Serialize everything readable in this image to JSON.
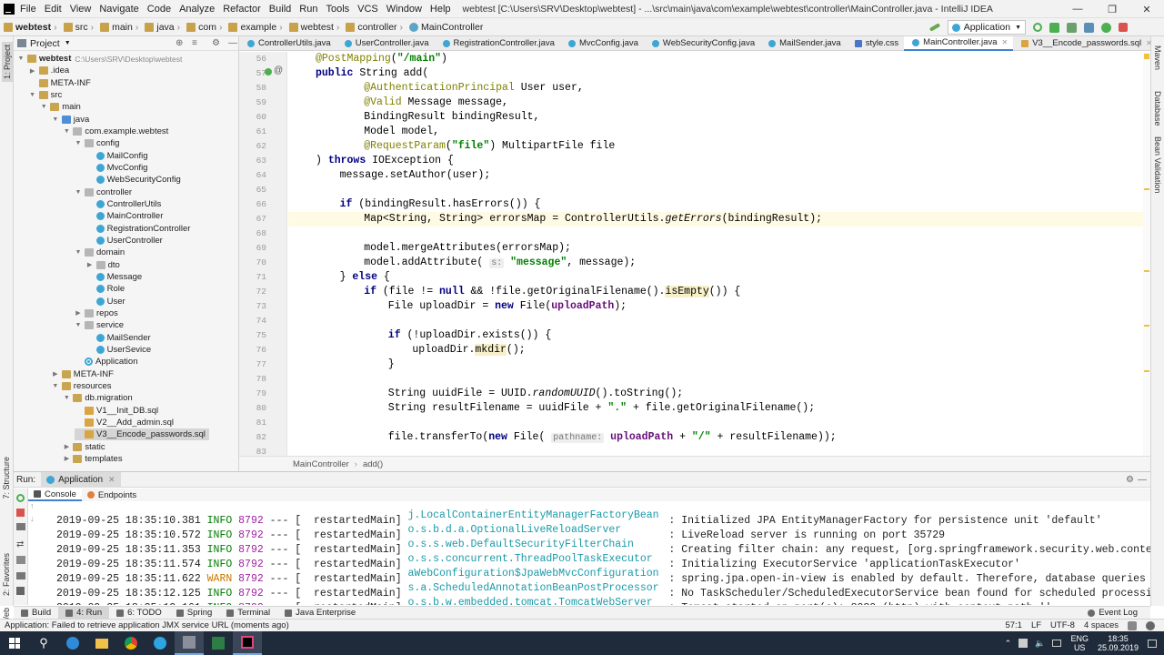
{
  "menubar": {
    "items": [
      "File",
      "Edit",
      "View",
      "Navigate",
      "Code",
      "Analyze",
      "Refactor",
      "Build",
      "Run",
      "Tools",
      "VCS",
      "Window",
      "Help"
    ],
    "window_title": "webtest [C:\\Users\\SRV\\Desktop\\webtest] - ...\\src\\main\\java\\com\\example\\webtest\\controller\\MainController.java - IntelliJ IDEA"
  },
  "navbar": {
    "breadcrumb": [
      "webtest",
      "src",
      "main",
      "java",
      "com",
      "example",
      "webtest",
      "controller",
      "MainController"
    ],
    "run_config": "Application"
  },
  "sidebar_left": {
    "project_label": "1: Project",
    "structure_label": "7: Structure",
    "favorites_label": "2: Favorites",
    "web_label": "Web"
  },
  "sidebar_right": {
    "maven_label": "Maven",
    "database_label": "Database",
    "bean_label": "Bean Validation"
  },
  "project": {
    "title": "Project",
    "root_name": "webtest",
    "root_path": "C:\\Users\\SRV\\Desktop\\webtest",
    "tree": [
      {
        "label": "webtest",
        "depth": 0,
        "icon": "folder",
        "arrow": "open",
        "path": "C:\\Users\\SRV\\Desktop\\webtest"
      },
      {
        "label": ".idea",
        "depth": 1,
        "icon": "folder",
        "arrow": "closed"
      },
      {
        "label": "META-INF",
        "depth": 1,
        "icon": "folder",
        "arrow": ""
      },
      {
        "label": "src",
        "depth": 1,
        "icon": "folder",
        "arrow": "open"
      },
      {
        "label": "main",
        "depth": 2,
        "icon": "folder",
        "arrow": "open"
      },
      {
        "label": "java",
        "depth": 3,
        "icon": "src",
        "arrow": "open"
      },
      {
        "label": "com.example.webtest",
        "depth": 4,
        "icon": "pkg",
        "arrow": "open"
      },
      {
        "label": "config",
        "depth": 5,
        "icon": "pkg",
        "arrow": "open"
      },
      {
        "label": "MailConfig",
        "depth": 6,
        "icon": "cls",
        "arrow": ""
      },
      {
        "label": "MvcConfig",
        "depth": 6,
        "icon": "cls",
        "arrow": ""
      },
      {
        "label": "WebSecurityConfig",
        "depth": 6,
        "icon": "cls",
        "arrow": ""
      },
      {
        "label": "controller",
        "depth": 5,
        "icon": "pkg",
        "arrow": "open"
      },
      {
        "label": "ControllerUtils",
        "depth": 6,
        "icon": "cls",
        "arrow": ""
      },
      {
        "label": "MainController",
        "depth": 6,
        "icon": "cls",
        "arrow": ""
      },
      {
        "label": "RegistrationController",
        "depth": 6,
        "icon": "cls",
        "arrow": ""
      },
      {
        "label": "UserController",
        "depth": 6,
        "icon": "cls",
        "arrow": ""
      },
      {
        "label": "domain",
        "depth": 5,
        "icon": "pkg",
        "arrow": "open"
      },
      {
        "label": "dto",
        "depth": 6,
        "icon": "pkg",
        "arrow": "closed"
      },
      {
        "label": "Message",
        "depth": 6,
        "icon": "cls",
        "arrow": ""
      },
      {
        "label": "Role",
        "depth": 6,
        "icon": "cls",
        "arrow": ""
      },
      {
        "label": "User",
        "depth": 6,
        "icon": "cls",
        "arrow": ""
      },
      {
        "label": "repos",
        "depth": 5,
        "icon": "pkg",
        "arrow": "closed"
      },
      {
        "label": "service",
        "depth": 5,
        "icon": "pkg",
        "arrow": "open"
      },
      {
        "label": "MailSender",
        "depth": 6,
        "icon": "cls",
        "arrow": ""
      },
      {
        "label": "UserSevice",
        "depth": 6,
        "icon": "cls",
        "arrow": ""
      },
      {
        "label": "Application",
        "depth": 5,
        "icon": "app",
        "arrow": ""
      },
      {
        "label": "META-INF",
        "depth": 3,
        "icon": "folder",
        "arrow": "closed"
      },
      {
        "label": "resources",
        "depth": 3,
        "icon": "folder",
        "arrow": "open"
      },
      {
        "label": "db.migration",
        "depth": 4,
        "icon": "folder",
        "arrow": "open"
      },
      {
        "label": "V1__Init_DB.sql",
        "depth": 5,
        "icon": "sql",
        "arrow": ""
      },
      {
        "label": "V2__Add_admin.sql",
        "depth": 5,
        "icon": "sql",
        "arrow": ""
      },
      {
        "label": "V3__Encode_passwords.sql",
        "depth": 5,
        "icon": "sql",
        "arrow": "",
        "selected": true
      },
      {
        "label": "static",
        "depth": 4,
        "icon": "folder",
        "arrow": "closed"
      },
      {
        "label": "templates",
        "depth": 4,
        "icon": "folder",
        "arrow": "closed"
      }
    ]
  },
  "tabs": [
    {
      "label": "ControllerUtils.java",
      "icon": "cls"
    },
    {
      "label": "UserController.java",
      "icon": "cls"
    },
    {
      "label": "RegistrationController.java",
      "icon": "cls"
    },
    {
      "label": "MvcConfig.java",
      "icon": "cls"
    },
    {
      "label": "WebSecurityConfig.java",
      "icon": "cls"
    },
    {
      "label": "MailSender.java",
      "icon": "cls"
    },
    {
      "label": "style.css",
      "icon": "css"
    },
    {
      "label": "MainController.java",
      "icon": "cls",
      "active": true
    },
    {
      "label": "V3__Encode_passwords.sql",
      "icon": "sql"
    }
  ],
  "editor": {
    "current_line": 67,
    "lines": [
      {
        "n": 56,
        "html": "<span class=\"an\">@PostMapping</span>(<span class=\"st\">\"/main\"</span>)",
        "indent": 1
      },
      {
        "n": 57,
        "html": "<span class=\"kw\">public</span> String add(",
        "indent": 1
      },
      {
        "n": 58,
        "html": "<span class=\"an\">@AuthenticationPrincipal</span> User user,",
        "indent": 3
      },
      {
        "n": 59,
        "html": "<span class=\"an\">@Valid</span> Message message,",
        "indent": 3
      },
      {
        "n": 60,
        "html": "BindingResult bindingResult,",
        "indent": 3
      },
      {
        "n": 61,
        "html": "Model model,",
        "indent": 3
      },
      {
        "n": 62,
        "html": "<span class=\"an\">@RequestParam</span>(<span class=\"st\">\"file\"</span>) MultipartFile file",
        "indent": 3
      },
      {
        "n": 63,
        "html": ") <span class=\"kw\">throws</span> IOException {",
        "indent": 1
      },
      {
        "n": 64,
        "html": "message.setAuthor(user);",
        "indent": 2
      },
      {
        "n": 65,
        "html": "",
        "indent": 0
      },
      {
        "n": 66,
        "html": "<span class=\"kw\">if</span> (bindingResult.hasErrors()) {",
        "indent": 2
      },
      {
        "n": 67,
        "html": "Map&lt;String, String&gt; errorsMap = ControllerUtils.<span class=\"it\">getErrors</span>(bindingResult);",
        "indent": 3
      },
      {
        "n": 68,
        "html": "",
        "indent": 0
      },
      {
        "n": 69,
        "html": "model.mergeAttributes(errorsMap);",
        "indent": 3
      },
      {
        "n": 70,
        "html": "model.addAttribute( <span class=\"hint\">s:</span> <span class=\"st\">\"message\"</span>, message);",
        "indent": 3
      },
      {
        "n": 71,
        "html": "} <span class=\"kw\">else</span> {",
        "indent": 2
      },
      {
        "n": 72,
        "html": "<span class=\"kw\">if</span> (file != <span class=\"kw\">null</span> &amp;&amp; !file.getOriginalFilename().<span class=\"hl\">isEmpty</span>()) {",
        "indent": 3
      },
      {
        "n": 73,
        "html": "File uploadDir = <span class=\"kw\">new</span> File(<span class=\"fld\">uploadPath</span>);",
        "indent": 4
      },
      {
        "n": 74,
        "html": "",
        "indent": 0
      },
      {
        "n": 75,
        "html": "<span class=\"kw\">if</span> (!uploadDir.exists()) {",
        "indent": 4
      },
      {
        "n": 76,
        "html": "uploadDir.<span class=\"hl\">mkdir</span>();",
        "indent": 5
      },
      {
        "n": 77,
        "html": "}",
        "indent": 4
      },
      {
        "n": 78,
        "html": "",
        "indent": 0
      },
      {
        "n": 79,
        "html": "String uuidFile = UUID.<span class=\"it\">randomUUID</span>().toString();",
        "indent": 4
      },
      {
        "n": 80,
        "html": "String resultFilename = uuidFile + <span class=\"st\">\".\"</span> + file.getOriginalFilename();",
        "indent": 4
      },
      {
        "n": 81,
        "html": "",
        "indent": 0
      },
      {
        "n": 82,
        "html": "file.transferTo(<span class=\"kw\">new</span> File( <span class=\"hint\">pathname:</span> <span class=\"fld\">uploadPath</span> + <span class=\"st\">\"/\"</span> + resultFilename));",
        "indent": 4
      },
      {
        "n": 83,
        "html": "",
        "indent": 0
      }
    ],
    "breadcrumb": [
      "MainController",
      "add()"
    ]
  },
  "run": {
    "label": "Run:",
    "tab": "Application",
    "subtabs": [
      "Console",
      "Endpoints"
    ],
    "logs": [
      {
        "ts": "2019-09-25 18:35:10.381",
        "lvl": "INFO",
        "pid": "8792",
        "thread": "restartedMain",
        "cls": "j.LocalContainerEntityManagerFactoryBean",
        "msg": "Initialized JPA EntityManagerFactory for persistence unit 'default'"
      },
      {
        "ts": "2019-09-25 18:35:10.572",
        "lvl": "INFO",
        "pid": "8792",
        "thread": "restartedMain",
        "cls": "o.s.b.d.a.OptionalLiveReloadServer",
        "msg": "LiveReload server is running on port 35729"
      },
      {
        "ts": "2019-09-25 18:35:11.353",
        "lvl": "INFO",
        "pid": "8792",
        "thread": "restartedMain",
        "cls": "o.s.s.web.DefaultSecurityFilterChain",
        "msg": "Creating filter chain: any request, [org.springframework.security.web.context.re"
      },
      {
        "ts": "2019-09-25 18:35:11.574",
        "lvl": "INFO",
        "pid": "8792",
        "thread": "restartedMain",
        "cls": "o.s.s.concurrent.ThreadPoolTaskExecutor",
        "msg": "Initializing ExecutorService 'applicationTaskExecutor'"
      },
      {
        "ts": "2019-09-25 18:35:11.622",
        "lvl": "WARN",
        "pid": "8792",
        "thread": "restartedMain",
        "cls": "aWebConfiguration$JpaWebMvcConfiguration",
        "msg": "spring.jpa.open-in-view is enabled by default. Therefore, database queries may be"
      },
      {
        "ts": "2019-09-25 18:35:12.125",
        "lvl": "INFO",
        "pid": "8792",
        "thread": "restartedMain",
        "cls": "s.a.ScheduledAnnotationBeanPostProcessor",
        "msg": "No TaskScheduler/ScheduledExecutorService bean found for scheduled processing"
      },
      {
        "ts": "2019-09-25 18:35:12.161",
        "lvl": "INFO",
        "pid": "8792",
        "thread": "restartedMain",
        "cls": "o.s.b.w.embedded.tomcat.TomcatWebServer",
        "msg": "Tomcat started on port(s): 8080 (http) with context path ''"
      }
    ]
  },
  "bottom_tabs": [
    "Build",
    "4: Run",
    "6: TODO",
    "Spring",
    "Terminal",
    "Java Enterprise"
  ],
  "event_log": "Event Log",
  "status": {
    "message": "Application: Failed to retrieve application JMX service URL (moments ago)",
    "position": "57:1",
    "line_sep": "LF",
    "encoding": "UTF-8",
    "indent": "4 spaces"
  },
  "taskbar": {
    "lang": "ENG",
    "region": "US",
    "time": "18:35",
    "date": "25.09.2019"
  },
  "colors": {
    "accent": "#4083c9",
    "info": "#008000",
    "warn": "#c77800",
    "pid": "#a020a0",
    "logger": "#1a9aa8"
  }
}
